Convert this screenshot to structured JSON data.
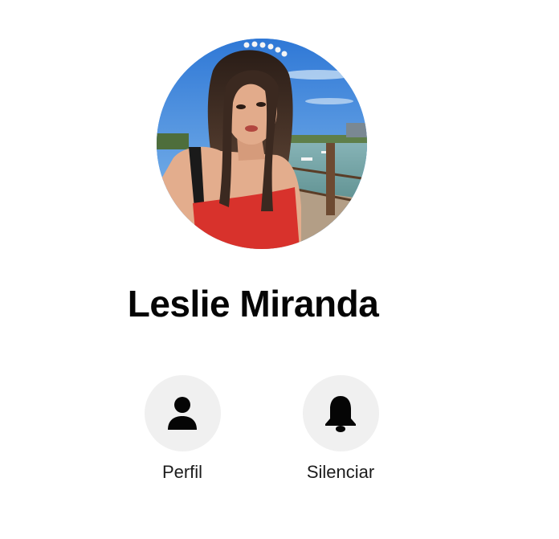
{
  "contact": {
    "name": "Leslie Miranda",
    "avatar_icon": "profile-photo"
  },
  "actions": [
    {
      "label": "Perfil",
      "icon": "person-icon"
    },
    {
      "label": "Silenciar",
      "icon": "bell-icon"
    }
  ],
  "colors": {
    "action_circle": "#f0f0f0",
    "text": "#050505",
    "icon": "#050505"
  }
}
